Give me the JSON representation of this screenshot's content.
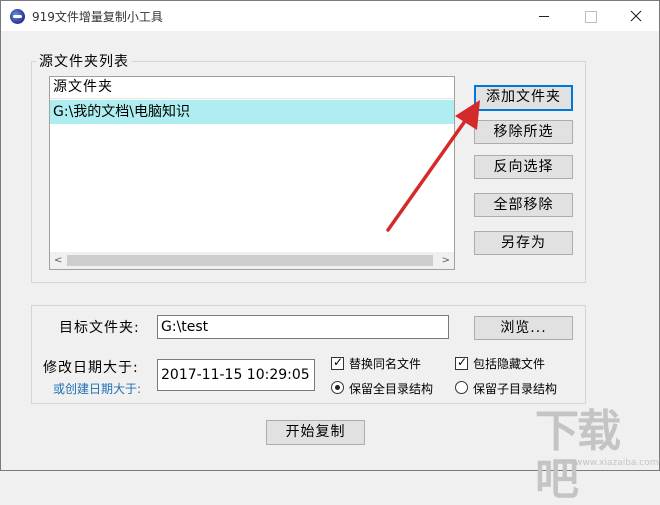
{
  "window": {
    "title": "919文件增量复制小工具"
  },
  "source_group": {
    "legend": "源文件夹列表",
    "list_header": "源文件夹",
    "rows": [
      "G:\\我的文档\\电脑知识"
    ]
  },
  "side_buttons": {
    "add_folder": "添加文件夹",
    "remove_selected": "移除所选",
    "invert_selection": "反向选择",
    "remove_all": "全部移除",
    "save_as": "另存为"
  },
  "target": {
    "label": "目标文件夹:",
    "value": "G:\\test",
    "browse": "浏览..."
  },
  "date": {
    "label": "修改日期大于:",
    "sublabel": "或创建日期大于:",
    "value": "2017-11-15 10:29:05"
  },
  "options": {
    "replace_same_name": {
      "label": "替换同名文件",
      "checked": true
    },
    "include_hidden": {
      "label": "包括隐藏文件",
      "checked": true
    },
    "keep_full_structure": {
      "label": "保留全目录结构",
      "selected": true
    },
    "keep_sub_structure": {
      "label": "保留子目录结构",
      "selected": false
    }
  },
  "start_button": "开始复制",
  "watermark": {
    "text": "下载吧",
    "sub": "www.xiazaiba.com"
  },
  "colors": {
    "selected_row": "#aeeef0",
    "arrow": "#d42a2a",
    "focus": "#0078d7"
  }
}
